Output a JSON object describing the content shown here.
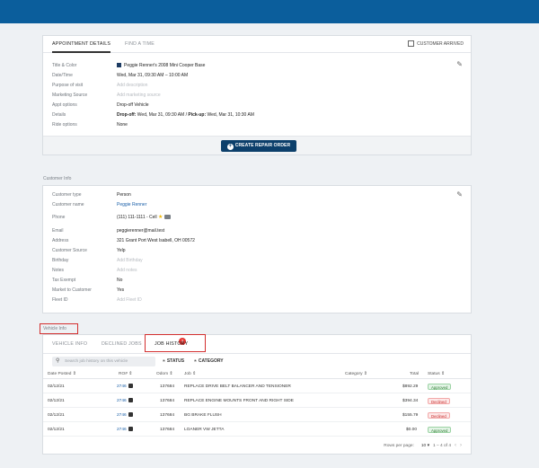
{
  "appointment": {
    "tabs": [
      "APPOINTMENT DETAILS",
      "FIND A TIME"
    ],
    "customer_arrived_label": "CUSTOMER ARRIVED",
    "rows": [
      {
        "label": "Title & Color",
        "value": "Peggie Renner's 2008 Mini Cooper Base",
        "type": "color"
      },
      {
        "label": "Date/Time",
        "value": "Wed, Mar 31, 09:30 AM – 10:00 AM",
        "type": "text"
      },
      {
        "label": "Purpose of visit",
        "value": "Add description",
        "type": "placeholder"
      },
      {
        "label": "Marketing Source",
        "value": "Add marketing source",
        "type": "placeholder"
      },
      {
        "label": "Appt options",
        "value": "Drop-off Vehicle",
        "type": "text"
      },
      {
        "label": "Details",
        "value": "",
        "type": "details"
      },
      {
        "label": "Ride options",
        "value": "None",
        "type": "text"
      }
    ],
    "details": {
      "dropoff_label": "Drop-off:",
      "dropoff_value": " Wed, Mar 31, 09:30 AM / ",
      "pickup_label": "Pick-up:",
      "pickup_value": " Wed, Mar 31, 10:30 AM"
    },
    "create_button_label": "CREATE REPAIR ORDER",
    "title_color": "#1d3c63"
  },
  "customer": {
    "section_title": "Customer Info",
    "rows": [
      {
        "label": "Customer type",
        "value": "Person"
      },
      {
        "label": "Customer name",
        "value": "Peggie Renner"
      },
      {
        "label": "Phone",
        "value": "(111) 111-1111 - Cell"
      },
      {
        "label": "Email",
        "value": "peggierenner@mail.test"
      },
      {
        "label": "Address",
        "value": "321 Grant Port West Isabell, OH 00572"
      },
      {
        "label": "Customer Source",
        "value": "Yelp"
      },
      {
        "label": "Birthday",
        "value": "Add Birthday"
      },
      {
        "label": "Notes",
        "value": "Add notes"
      },
      {
        "label": "Tax Exempt",
        "value": "No"
      },
      {
        "label": "Market to Customer",
        "value": "Yes"
      },
      {
        "label": "Fleet ID",
        "value": "Add Fleet ID"
      }
    ]
  },
  "vehicle": {
    "section_title": "Vehicle Info",
    "tabs": [
      "VEHICLE INFO",
      "DECLINED JOBS",
      "JOB HISTORY"
    ],
    "declined_badge": "2",
    "search_placeholder": "Search job history on this vehicle",
    "filters": [
      "STATUS",
      "CATEGORY"
    ],
    "columns": [
      "Date Posted",
      "RO#",
      "Odom",
      "Job",
      "Category",
      "Total",
      "Status"
    ],
    "rows": [
      {
        "date": "02/12/21",
        "ro": "2746",
        "odom": "137684",
        "job": "REPLACE DRIVE BELT BALANCER AND TENSIONER",
        "category": "",
        "total": "$892.29",
        "status": "Approved"
      },
      {
        "date": "02/12/21",
        "ro": "2746",
        "odom": "137684",
        "job": "REPLACE ENGINE MOUNTS FRONT AND RIGHT SIDE",
        "category": "",
        "total": "$394.34",
        "status": "Declined"
      },
      {
        "date": "02/12/21",
        "ro": "2746",
        "odom": "137684",
        "job": "BG BRAKE FLUSH",
        "category": "",
        "total": "$155.79",
        "status": "Declined"
      },
      {
        "date": "02/12/21",
        "ro": "2746",
        "odom": "137684",
        "job": "LOANER VW JETTA",
        "category": "",
        "total": "$0.00",
        "status": "Approved"
      }
    ],
    "pager": {
      "rows_label": "Rows per page:",
      "rows_value": "10",
      "range": "1 – 4 of 4"
    }
  },
  "colors": {
    "topbar": "#0b5e9c",
    "button": "#0c3f6b",
    "link": "#1a5fa8",
    "highlight": "#d32f2f"
  }
}
